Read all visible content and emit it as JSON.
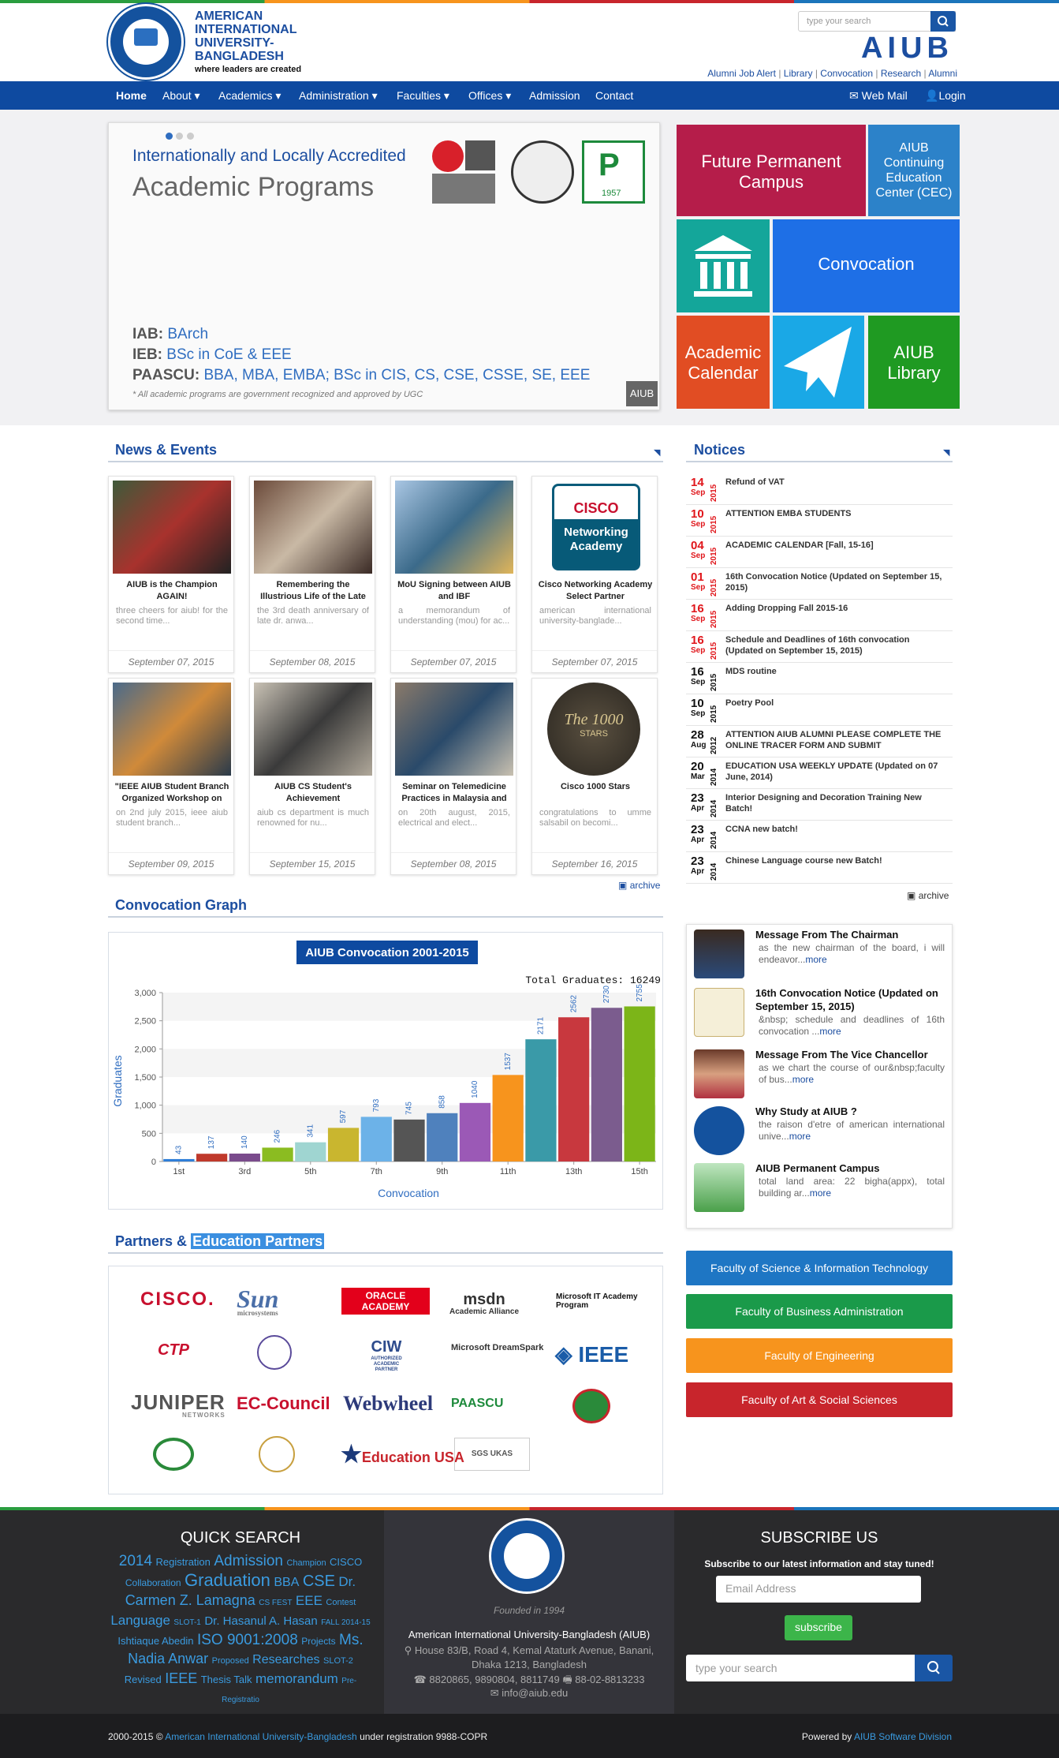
{
  "header": {
    "brand_line1": "AMERICAN",
    "brand_line2": "INTERNATIONAL",
    "brand_line3": "UNIVERSITY-",
    "brand_line4": "BANGLADESH",
    "tagline": "where leaders are created",
    "search_placeholder": "type your search",
    "wordmark": "AIUB",
    "links": [
      "Alumni Job Alert",
      "Library",
      "Convocation",
      "Research",
      "Alumni"
    ]
  },
  "nav": {
    "items": [
      "Home",
      "About",
      "Academics",
      "Administration",
      "Faculties",
      "Offices",
      "Admission",
      "Contact"
    ],
    "webmail": "Web Mail",
    "login": "Login"
  },
  "slider": {
    "headline": "Internationally and Locally Accredited",
    "subhead": "Academic Programs",
    "line1_org": "IAB:",
    "line1_prog": "BArch",
    "line2_org": "IEB:",
    "line2_prog": "BSc in CoE & EEE",
    "line3_org": "PAASCU:",
    "line3_prog": "BBA, MBA, EMBA; BSc in CIS, CS, CSE, CSSE, SE, EEE",
    "note": "* All academic programs are government recognized and approved by UGC",
    "badge": "AIUB",
    "seal_year": "1957"
  },
  "tiles": {
    "campus": "Future Permanent Campus",
    "cec": "AIUB Continuing Education Center (CEC)",
    "convocation": "Convocation",
    "calendar": "Academic Calendar",
    "library": "AIUB Library"
  },
  "news": {
    "title": "News & Events",
    "archive": "archive",
    "items": [
      {
        "title": "AIUB is the Champion AGAIN!",
        "summary": "three cheers for aiub! for the second time...",
        "date": "September 07, 2015"
      },
      {
        "title": "Remembering the Illustrious Life of the Late",
        "summary": "the 3rd death anniversary of late dr. anwa...",
        "date": "September 08, 2015"
      },
      {
        "title": "MoU Signing between AIUB and IBF",
        "summary": "a memorandum of understanding (mou) for ac...",
        "date": "September 07, 2015"
      },
      {
        "title": "Cisco Networking Academy Select Partner",
        "summary": "american international university-banglade...",
        "date": "September 07, 2015"
      },
      {
        "title": "\"IEEE AIUB Student Branch Organized Workshop on",
        "summary": "on 2nd july 2015, ieee aiub student branch...",
        "date": "September 09, 2015"
      },
      {
        "title": "AIUB CS Student's Achievement",
        "summary": "aiub cs department is much renowned for nu...",
        "date": "September 15, 2015"
      },
      {
        "title": "Seminar on Telemedicine Practices in Malaysia and",
        "summary": "on 20th august, 2015, electrical and elect...",
        "date": "September 08, 2015"
      },
      {
        "title": "Cisco 1000 Stars",
        "summary": "congratulations to umme salsabil on becomi...",
        "date": "September 16, 2015"
      }
    ],
    "cisco_word": "CISCO",
    "cisco_sub1": "Networking",
    "cisco_sub2": "Academy",
    "stars_num": "The 1000",
    "stars_word": "STARS"
  },
  "notices": {
    "title": "Notices",
    "archive": "archive",
    "items": [
      {
        "day": "14",
        "mon": "Sep",
        "year": "2015",
        "text": "Refund of VAT",
        "red": true
      },
      {
        "day": "10",
        "mon": "Sep",
        "year": "2015",
        "text": "ATTENTION EMBA STUDENTS",
        "red": true
      },
      {
        "day": "04",
        "mon": "Sep",
        "year": "2015",
        "text": "ACADEMIC CALENDAR [Fall, 15-16]",
        "red": true
      },
      {
        "day": "01",
        "mon": "Sep",
        "year": "2015",
        "text": "16th Convocation Notice (Updated on September 15, 2015)",
        "red": true
      },
      {
        "day": "16",
        "mon": "Sep",
        "year": "2015",
        "text": "Adding Dropping Fall 2015-16",
        "red": true
      },
      {
        "day": "16",
        "mon": "Sep",
        "year": "2015",
        "text": "Schedule and Deadlines of 16th convocation (Updated on September 15, 2015)",
        "red": true
      },
      {
        "day": "16",
        "mon": "Sep",
        "year": "2015",
        "text": "MDS routine",
        "red": false
      },
      {
        "day": "10",
        "mon": "Sep",
        "year": "2015",
        "text": "Poetry Pool",
        "red": false
      },
      {
        "day": "28",
        "mon": "Aug",
        "year": "2012",
        "text": "ATTENTION AIUB ALUMNI PLEASE COMPLETE THE ONLINE TRACER FORM AND SUBMIT",
        "red": false
      },
      {
        "day": "20",
        "mon": "Mar",
        "year": "2014",
        "text": "EDUCATION USA WEEKLY UPDATE (Updated on 07 June, 2014)",
        "red": false
      },
      {
        "day": "23",
        "mon": "Apr",
        "year": "2014",
        "text": "Interior Designing and Decoration Training New Batch!",
        "red": false
      },
      {
        "day": "23",
        "mon": "Apr",
        "year": "2014",
        "text": "CCNA new batch!",
        "red": false
      },
      {
        "day": "23",
        "mon": "Apr",
        "year": "2014",
        "text": "Chinese Language course new Batch!",
        "red": false
      }
    ]
  },
  "messages": [
    {
      "title": "Message From The Chairman",
      "body": "as the new chairman of the board, i will endeavor...",
      "more": "more"
    },
    {
      "title": "16th Convocation Notice (Updated on September 15, 2015)",
      "body": "&nbsp; schedule and deadlines of 16th convocation ...",
      "more": "more"
    },
    {
      "title": "Message From The Vice Chancellor",
      "body": "as we chart the course of our&nbsp;faculty of bus...",
      "more": "more"
    },
    {
      "title": "Why Study at AIUB ?",
      "body": "the raison d'etre of american international unive...",
      "more": "more"
    },
    {
      "title": "AIUB Permanent Campus",
      "body": "total land area: 22 bigha(appx), total building ar...",
      "more": "more"
    }
  ],
  "faculties": [
    "Faculty of Science & Information Technology",
    "Faculty of Business Administration",
    "Faculty of Engineering",
    "Faculty of Art & Social Sciences"
  ],
  "graph_section": {
    "title": "Convocation Graph",
    "total_label": "Total Graduates: 16249"
  },
  "chart_data": {
    "type": "bar",
    "title": "AIUB Convocation 2001-2015",
    "xlabel": "Convocation",
    "ylabel": "Graduates",
    "ylim": [
      0,
      3000
    ],
    "yticks": [
      "0",
      "500",
      "1,000",
      "1,500",
      "2,000",
      "2,500",
      "3,000"
    ],
    "categories": [
      "1st",
      "2nd",
      "3rd",
      "4th",
      "5th",
      "6th",
      "7th",
      "8th",
      "9th",
      "10th",
      "11th",
      "12th",
      "13th",
      "14th",
      "15th"
    ],
    "xtick_labels": [
      "1st",
      "3rd",
      "5th",
      "7th",
      "9th",
      "11th",
      "13th",
      "15th"
    ],
    "values": [
      43,
      137,
      140,
      246,
      341,
      597,
      793,
      745,
      858,
      1040,
      1537,
      2171,
      2562,
      2730,
      2755
    ],
    "colors": [
      "#2f7ed8",
      "#c0392b",
      "#7a4b8c",
      "#8bbc21",
      "#9fd5d1",
      "#c9b62f",
      "#6cb2e8",
      "#555555",
      "#4f81bd",
      "#9b59b6",
      "#f7941d",
      "#3a9aa8",
      "#c8383e",
      "#7b5c8e",
      "#7cb518"
    ]
  },
  "partners": {
    "title_a": "Partners &",
    "title_b": "Education Partners",
    "logos": [
      "CISCO.",
      "Sun",
      "ORACLE ACADEMY",
      "msdn Academic Alliance",
      "Microsoft IT Academy Program",
      "CTP",
      "CIW",
      "Microsoft DreamSpark",
      "IEEE",
      "JUNIPER",
      "EC-Council",
      "Webwheel",
      "PAASCU",
      "Education USA",
      "SGS UKAS"
    ],
    "sun_sub": "microsystems",
    "msdn_sub": "Academic Alliance",
    "ciw_sub": "AUTHORIZED ACADEMIC PARTNER",
    "juniper_sub": "NETWORKS"
  },
  "footer": {
    "quick_title": "QUICK SEARCH",
    "tags": [
      "2014",
      "Registration",
      "Admission",
      "Champion",
      "CISCO",
      "Collaboration",
      "Graduation",
      "BBA",
      "CSE",
      "Dr.",
      "Carmen Z. Lamagna",
      "CS FEST",
      "EEE",
      "Contest",
      "Language",
      "SLOT-1",
      "Dr. Hasanul A. Hasan",
      "FALL 2014-15",
      "Ishtiaque Abedin",
      "ISO 9001:2008",
      "Projects",
      "Ms.",
      "Nadia Anwar",
      "Proposed",
      "Researches",
      "SLOT-2",
      "Revised",
      "IEEE",
      "Thesis Talk",
      "memorandum",
      "Pre-Registratio"
    ],
    "founded": "Founded in 1994",
    "org": "American International University-Bangladesh (AIUB)",
    "addr1": "House 83/B, Road 4, Kemal Ataturk Avenue, Banani,",
    "addr2": "Dhaka 1213, Bangladesh",
    "phone": "8820865, 9890804, 8811749",
    "fax": "88-02-8813233",
    "email": "info@aiub.edu",
    "subscribe_title": "SUBSCRIBE US",
    "subscribe_text": "Subscribe to our latest information and stay tuned!",
    "email_placeholder": "Email Address",
    "subscribe_btn": "subscribe",
    "search_placeholder": "type your search"
  },
  "bottom": {
    "years": "2000-2015",
    "org": "American International University-Bangladesh",
    "reg": "under registration 9988-COPR",
    "powered": "Powered by",
    "division": "AIUB Software Division"
  }
}
